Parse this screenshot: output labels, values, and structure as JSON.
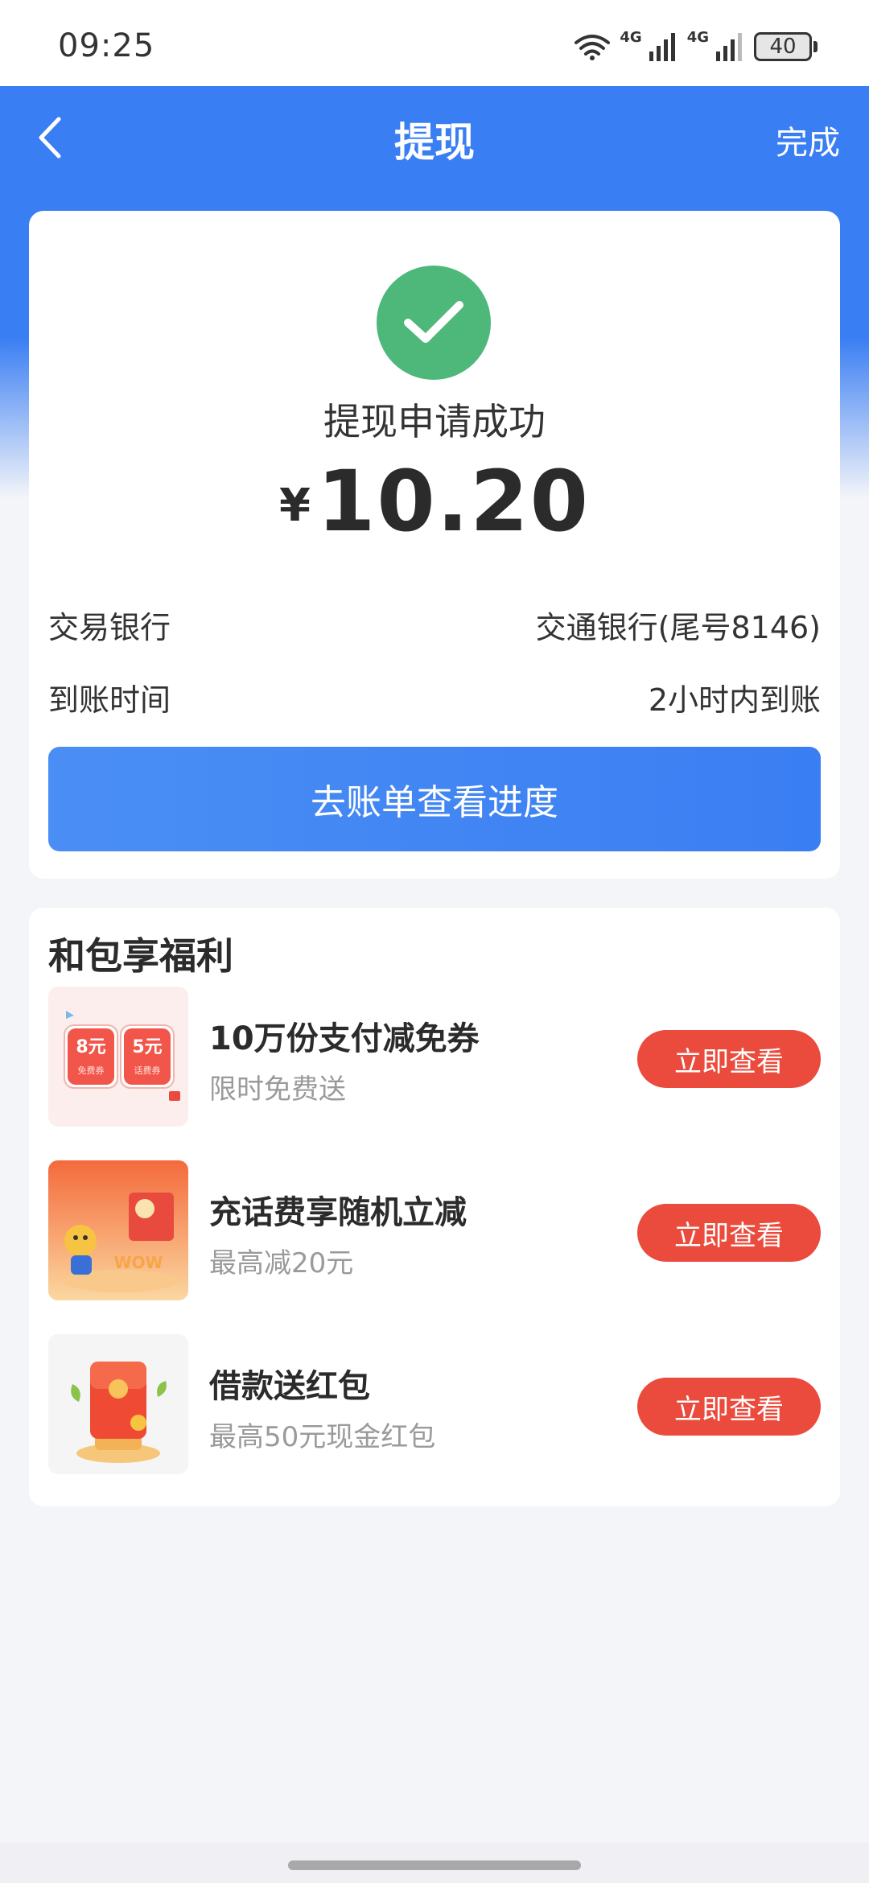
{
  "status_bar": {
    "time": "09:25",
    "network_1": "4G",
    "network_2": "4G",
    "battery": "40"
  },
  "nav": {
    "title": "提现",
    "done": "完成"
  },
  "result": {
    "status_text": "提现申请成功",
    "currency": "¥",
    "amount": "10.20",
    "rows": [
      {
        "label": "交易银行",
        "value": "交通银行(尾号8146)"
      },
      {
        "label": "到账时间",
        "value": "2小时内到账"
      }
    ],
    "button_label": "去账单查看进度"
  },
  "benefits": {
    "title": "和包享福利",
    "items": [
      {
        "title": "10万份支付减免券",
        "subtitle": "限时免费送",
        "button": "立即查看",
        "badge_1": "8元",
        "badge_2": "5元",
        "badge_sub_1": "免费券",
        "badge_sub_2": "话费券"
      },
      {
        "title": "充话费享随机立减",
        "subtitle": "最高减20元",
        "button": "立即查看",
        "thumb_text": "WOW"
      },
      {
        "title": "借款送红包",
        "subtitle": "最高50元现金红包",
        "button": "立即查看"
      }
    ]
  },
  "colors": {
    "brand_blue": "#3a7ef3",
    "success_green": "#4db87a",
    "action_red": "#ea4b3c"
  }
}
